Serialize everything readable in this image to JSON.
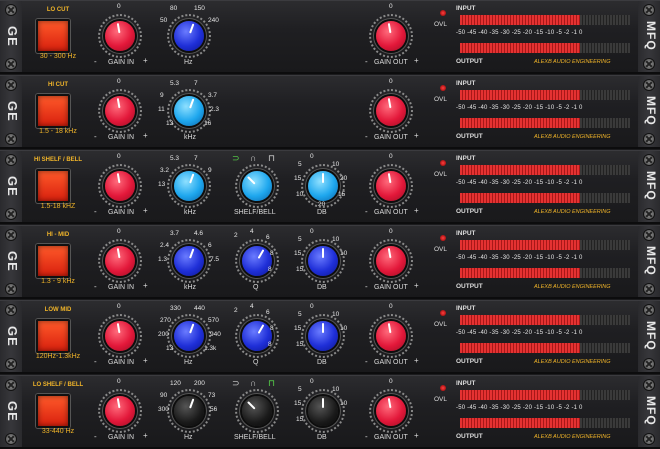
{
  "brand": {
    "left": "GE",
    "right": "MFQ",
    "engineer": "ALEXB AUDIO ENGINEERING"
  },
  "meter": {
    "input_label": "INPUT",
    "output_label": "OUTPUT",
    "ovl_label": "OVL",
    "scale": "-50  -45  -40  -35  -30  -25  -20  -15  -10   -5   -2   -1   0"
  },
  "common": {
    "gain_in": "GAIN IN",
    "gain_out": "GAIN OUT",
    "zero": "0",
    "minus": "-",
    "plus": "+",
    "minus_marks": "-6 6"
  },
  "strips": [
    {
      "title": "LO CUT",
      "range": "30 - 300 Hz",
      "freq": {
        "label": "Hz",
        "ticks": [
          "80",
          "150",
          "50",
          "240"
        ],
        "color": "blue"
      }
    },
    {
      "title": "HI CUT",
      "range": "1.5 - 18 kHz",
      "freq": {
        "label": "kHz",
        "ticks": [
          "5.3",
          "7",
          "9",
          "3.7",
          "11",
          "2.3",
          "13",
          "16"
        ],
        "color": "cyan"
      }
    },
    {
      "title": "HI SHELF / BELL",
      "range": "1.5-18 kHZ",
      "freq": {
        "label": "kHz",
        "ticks": [
          "5.3",
          "7",
          "3.2",
          "9",
          "13"
        ],
        "color": "cyan"
      },
      "mode": {
        "label": "SHELF/BELL",
        "shapes": [
          "⊃",
          "∩",
          "⊓"
        ],
        "active": 0
      },
      "db": {
        "label": "DB",
        "ticks": [
          "0",
          "5",
          "10",
          "15",
          "20",
          "10",
          "15",
          "20"
        ],
        "color": "cyan"
      }
    },
    {
      "title": "HI - MID",
      "range": "1.3 - 9 kHz",
      "freq": {
        "label": "kHz",
        "ticks": [
          "3.7",
          "4.6",
          "2.4",
          "6",
          "1.3",
          "7.5"
        ],
        "color": "blue"
      },
      "q": {
        "label": "Q",
        "ticks": [
          "2",
          "4",
          "6",
          "8",
          "8"
        ],
        "color": "blue"
      },
      "db": {
        "label": "DB",
        "ticks": [
          "0",
          "5",
          "10",
          "15",
          "10",
          "15"
        ],
        "color": "blue"
      }
    },
    {
      "title": "LOW MID",
      "range": "120Hz-1.3kHz",
      "freq": {
        "label": "Hz",
        "ticks": [
          "330",
          "440",
          "270",
          "570",
          "200",
          "940",
          "13",
          "1.3k"
        ],
        "color": "blue"
      },
      "q": {
        "label": "Q",
        "ticks": [
          "2",
          "4",
          "6",
          "8",
          "8"
        ],
        "color": "blue"
      },
      "db": {
        "label": "DB",
        "ticks": [
          "0",
          "5",
          "10",
          "15",
          "10",
          "15"
        ],
        "color": "blue"
      }
    },
    {
      "title": "LO SHELF / BELL",
      "range": "33-440 Hz",
      "freq": {
        "label": "Hz",
        "ticks": [
          "120",
          "200",
          "90",
          "73",
          "300",
          "56"
        ],
        "color": "black"
      },
      "mode": {
        "label": "SHELF/BELL",
        "shapes": [
          "⊃",
          "∩",
          "⊓"
        ],
        "active": 2
      },
      "db": {
        "label": "DB",
        "ticks": [
          "0",
          "5",
          "10",
          "15",
          "10",
          "15"
        ],
        "color": "black"
      }
    }
  ]
}
